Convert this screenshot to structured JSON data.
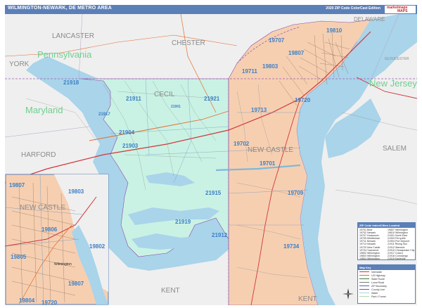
{
  "header": {
    "title": "WILMINGTON-NEWARK, DE METRO AREA",
    "edition": "2020 ZIP Code ColorCast Edition",
    "logo_line1": "marketmaps",
    "logo_line2": "MAPS"
  },
  "colors": {
    "maryland_zip": "#c9f2e4",
    "delaware_zip": "#f6cfb1",
    "water": "#a9d4ea",
    "background_land": "#f1f1f1",
    "header": "#5b7fb7",
    "highway": "#d2363a",
    "road": "#7a7a7a"
  },
  "map_labels": {
    "counties": {
      "lancaster": "LANCASTER",
      "chester": "CHESTER",
      "york": "YORK",
      "harford": "HARFORD",
      "cecil": "CECIL",
      "new_castle": "NEW CASTLE",
      "salem": "SALEM",
      "kent_md": "KENT",
      "kent_de": "KENT",
      "delaware": "DELAWARE",
      "gloucester": "GLOUCESTER"
    },
    "states": {
      "pennsylvania": "Pennsylvania",
      "maryland": "Maryland",
      "new_jersey": "New Jersey"
    },
    "zip_codes": {
      "z21918": "21918",
      "z21911": "21911",
      "z21921": "21921",
      "z21901": "21901",
      "z21917": "21917",
      "z21904": "21904",
      "z21903": "21903",
      "z21915": "21915",
      "z21919": "21919",
      "z21912": "21912",
      "z19707": "19707",
      "z19807": "19807",
      "z19810": "19810",
      "z19803": "19803",
      "z19711": "19711",
      "z19713": "19713",
      "z19720": "19720",
      "z19702": "19702",
      "z19701": "19701",
      "z19709": "19709",
      "z19734": "19734"
    },
    "inset": {
      "county": "NEW CASTLE",
      "z19807": "19807",
      "z19803": "19803",
      "z19806": "19806",
      "z19802": "19802",
      "z19805": "19805",
      "z19807b": "19807",
      "z19804": "19804",
      "z19720": "19720",
      "city": "Wilmington"
    }
  },
  "legend_table": {
    "title": "ZIP Code Index/Cities Located",
    "rows": [
      "19701 Bear",
      "19702 Newark",
      "19707 Hockessin",
      "19709 Middletown",
      "19711 Newark",
      "19713 Newark",
      "19720 New Castle",
      "19734 Townsend",
      "19802 Wilmington",
      "19803 Wilmington",
      "19804 Wilmington",
      "19805 Wilmington",
      "19806 Wilmington",
      "19807 Wilmington",
      "19810 Wilmington",
      "21901 North East",
      "21903 Perryville",
      "21904 Port Deposit",
      "21911 Rising Sun",
      "21912 Warwick",
      "21915 Chesapeake City",
      "21917 Colora",
      "21918 Conowingo",
      "21919 Earleville",
      "21921 Elkton"
    ]
  },
  "key_table": {
    "title": "Map Key",
    "rows": [
      {
        "label": "Interstate",
        "color": "#d2363a"
      },
      {
        "label": "US Highway",
        "color": "#e46b2c"
      },
      {
        "label": "State Route",
        "color": "#3a7f3a"
      },
      {
        "label": "Local Road",
        "color": "#7a7a7a"
      },
      {
        "label": "ZIP Boundary",
        "color": "#4a6fa5"
      },
      {
        "label": "County Line",
        "color": "#8d4aa5"
      },
      {
        "label": "Water",
        "color": "#a9d4ea"
      },
      {
        "label": "Park / Forest",
        "color": "#b7d9a4"
      }
    ]
  }
}
